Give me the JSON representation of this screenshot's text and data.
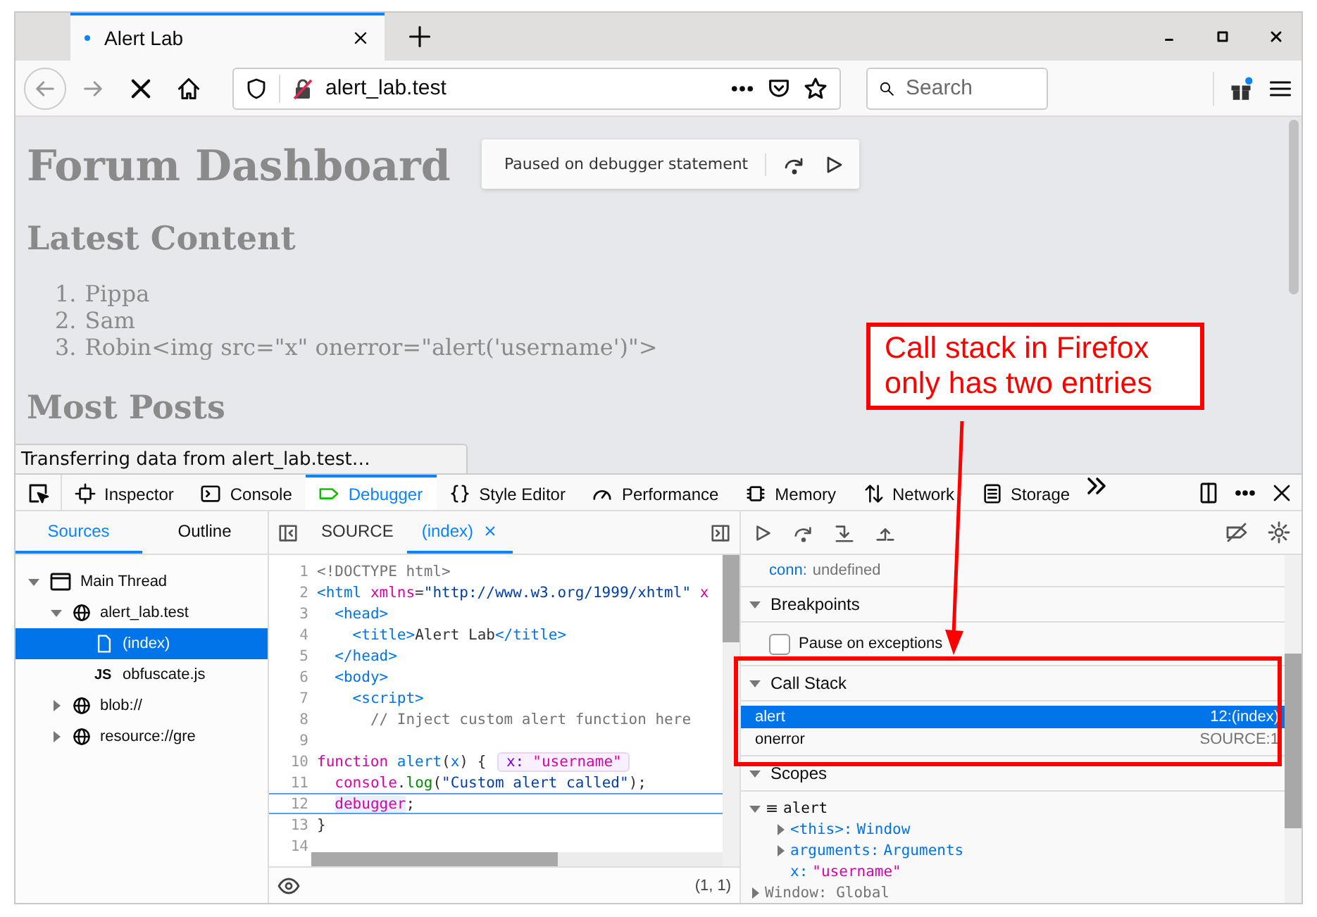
{
  "browser": {
    "tab": {
      "title": "Alert Lab",
      "loading": true
    },
    "address": "alert_lab.test",
    "search": {
      "placeholder": "Search"
    }
  },
  "page": {
    "heading": "Forum Dashboard",
    "sections": [
      {
        "heading": "Latest Content",
        "items": [
          {
            "number": "1.",
            "text": "Pippa"
          },
          {
            "number": "2.",
            "text": "Sam"
          },
          {
            "number": "3.",
            "text": "Robin<img src=\"x\" onerror=\"alert('username')\">"
          }
        ]
      },
      {
        "heading": "Most Posts"
      }
    ]
  },
  "paused_overlay": {
    "message": "Paused on debugger statement"
  },
  "status_bar": "Transferring data from alert_lab.test…",
  "annotation": {
    "text": "Call stack in Firefox only has two entries"
  },
  "devtools": {
    "tools": [
      {
        "label": "Inspector",
        "selected": false
      },
      {
        "label": "Console",
        "selected": false
      },
      {
        "label": "Debugger",
        "selected": true
      },
      {
        "label": "Style Editor",
        "selected": false
      },
      {
        "label": "Performance",
        "selected": false
      },
      {
        "label": "Memory",
        "selected": false
      },
      {
        "label": "Network",
        "selected": false
      },
      {
        "label": "Storage",
        "selected": false
      }
    ],
    "sources_tabs": [
      {
        "label": "Sources",
        "selected": true
      },
      {
        "label": "Outline",
        "selected": false
      }
    ],
    "tree": [
      {
        "label": "Main Thread",
        "kind": "thread",
        "expanded": true,
        "selected": false,
        "children": [
          {
            "label": "alert_lab.test",
            "kind": "domain",
            "expanded": true,
            "selected": false,
            "children": [
              {
                "label": "(index)",
                "kind": "file",
                "selected": true
              },
              {
                "label": "obfuscate.js",
                "kind": "js",
                "icon_text": "JS",
                "selected": false
              }
            ]
          },
          {
            "label": "blob://",
            "kind": "domain",
            "expanded": false,
            "selected": false
          },
          {
            "label": "resource://gre",
            "kind": "domain",
            "expanded": false,
            "selected": false
          }
        ]
      }
    ],
    "editor_tabs": [
      {
        "label": "SOURCE",
        "selected": false,
        "closable": false
      },
      {
        "label": "(index)",
        "selected": true,
        "closable": true
      }
    ],
    "code": [
      {
        "number": "1",
        "paused": false,
        "segments": [
          {
            "kind": "doctype",
            "text": "<!DOCTYPE html>"
          }
        ]
      },
      {
        "number": "2",
        "paused": false,
        "segments": [
          {
            "kind": "tag",
            "text": "<html"
          },
          {
            "kind": "attr",
            "text": " xmlns"
          },
          {
            "kind": "plain",
            "text": "="
          },
          {
            "kind": "string",
            "text": "\"http://www.w3.org/1999/xhtml\""
          },
          {
            "kind": "attr",
            "text": " x"
          }
        ]
      },
      {
        "number": "3",
        "paused": false,
        "segments": [
          {
            "kind": "tag",
            "text": "  <head>"
          }
        ]
      },
      {
        "number": "4",
        "paused": false,
        "segments": [
          {
            "kind": "tag",
            "text": "    <title>"
          },
          {
            "kind": "plain",
            "text": "Alert Lab"
          },
          {
            "kind": "tag",
            "text": "</title>"
          }
        ]
      },
      {
        "number": "5",
        "paused": false,
        "segments": [
          {
            "kind": "tag",
            "text": "  </head>"
          }
        ]
      },
      {
        "number": "6",
        "paused": false,
        "segments": [
          {
            "kind": "tag",
            "text": "  <body>"
          }
        ]
      },
      {
        "number": "7",
        "paused": false,
        "segments": [
          {
            "kind": "tag",
            "text": "    <script>"
          }
        ]
      },
      {
        "number": "8",
        "paused": false,
        "segments": [
          {
            "kind": "comment",
            "text": "      // Inject custom alert function here"
          }
        ]
      },
      {
        "number": "9",
        "paused": false
      },
      {
        "number": "10",
        "paused": false,
        "segments": [
          {
            "kind": "keyword",
            "text": "function"
          },
          {
            "kind": "name",
            "text": " alert"
          },
          {
            "kind": "plain",
            "text": "("
          },
          {
            "kind": "name",
            "text": "x"
          },
          {
            "kind": "plain",
            "text": ") { "
          }
        ],
        "preview": {
          "name": "x:",
          "value": "\"username\""
        }
      },
      {
        "number": "11",
        "paused": false,
        "segments": [
          {
            "kind": "keyword",
            "text": "  console"
          },
          {
            "kind": "plain",
            "text": "."
          },
          {
            "kind": "method",
            "text": "log"
          },
          {
            "kind": "plain",
            "text": "("
          },
          {
            "kind": "string",
            "text": "\"Custom alert called\""
          },
          {
            "kind": "plain",
            "text": ");"
          }
        ]
      },
      {
        "number": "12",
        "paused": true,
        "segments": [
          {
            "kind": "keyword",
            "text": "  debugger"
          },
          {
            "kind": "plain",
            "text": ";"
          }
        ]
      },
      {
        "number": "13",
        "paused": false,
        "segments": [
          {
            "kind": "plain",
            "text": "}"
          }
        ]
      },
      {
        "number": "14",
        "paused": false
      }
    ],
    "cursor": "(1, 1)",
    "watch": {
      "name": "conn:",
      "value": "undefined"
    },
    "sections": [
      {
        "kind": "breakpoints",
        "title": "Breakpoints",
        "expanded": true,
        "options": [
          {
            "label": "Pause on exceptions",
            "checked": false
          }
        ]
      },
      {
        "kind": "callstack",
        "title": "Call Stack",
        "expanded": true,
        "frames": [
          {
            "name": "alert",
            "location": "12:(index)",
            "selected": true
          },
          {
            "name": "onerror",
            "location": "SOURCE:1",
            "selected": false
          }
        ]
      },
      {
        "kind": "scopes",
        "title": "Scopes",
        "expanded": true,
        "scopes": [
          {
            "label": "alert",
            "expanded": true,
            "children": [
              {
                "name": "<this>:",
                "value": "Window",
                "kind": "object",
                "expanded": false
              },
              {
                "name": "arguments:",
                "value": "Arguments",
                "kind": "object",
                "expanded": false
              },
              {
                "name": "x:",
                "value": "\"username\"",
                "kind": "string"
              }
            ]
          },
          {
            "label": "Window: Global",
            "expanded": false
          }
        ]
      }
    ]
  }
}
